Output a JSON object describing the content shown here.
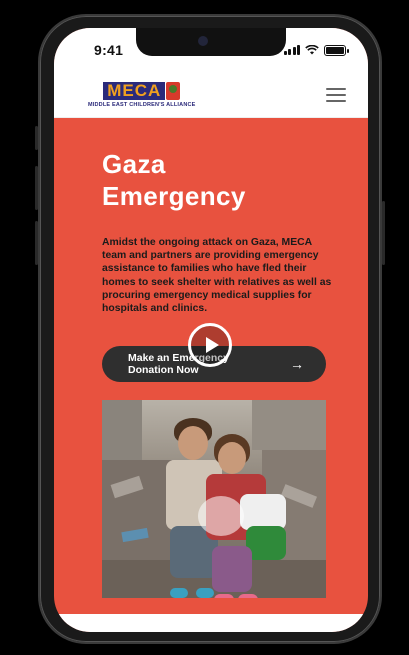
{
  "status_bar": {
    "time": "9:41"
  },
  "header": {
    "logo_letters": "MECA",
    "logo_subtitle": "MIDDLE EAST CHILDREN'S ALLIANCE"
  },
  "hero": {
    "title_line1": "Gaza",
    "title_line2": "Emergency",
    "description": "Amidst the ongoing attack on Gaza, MECA team and partners are providing emergency assistance to families who have fled their homes to seek shelter with relatives as well as procuring emergency medical supplies for hospitals and clinics.",
    "cta_label": "Make an Emergency Donation Now",
    "cta_arrow": "→"
  },
  "colors": {
    "hero_bg": "#e8523f",
    "cta_bg": "#2f2f2f",
    "logo_blue": "#2b2a7a",
    "logo_orange": "#f0a020"
  }
}
